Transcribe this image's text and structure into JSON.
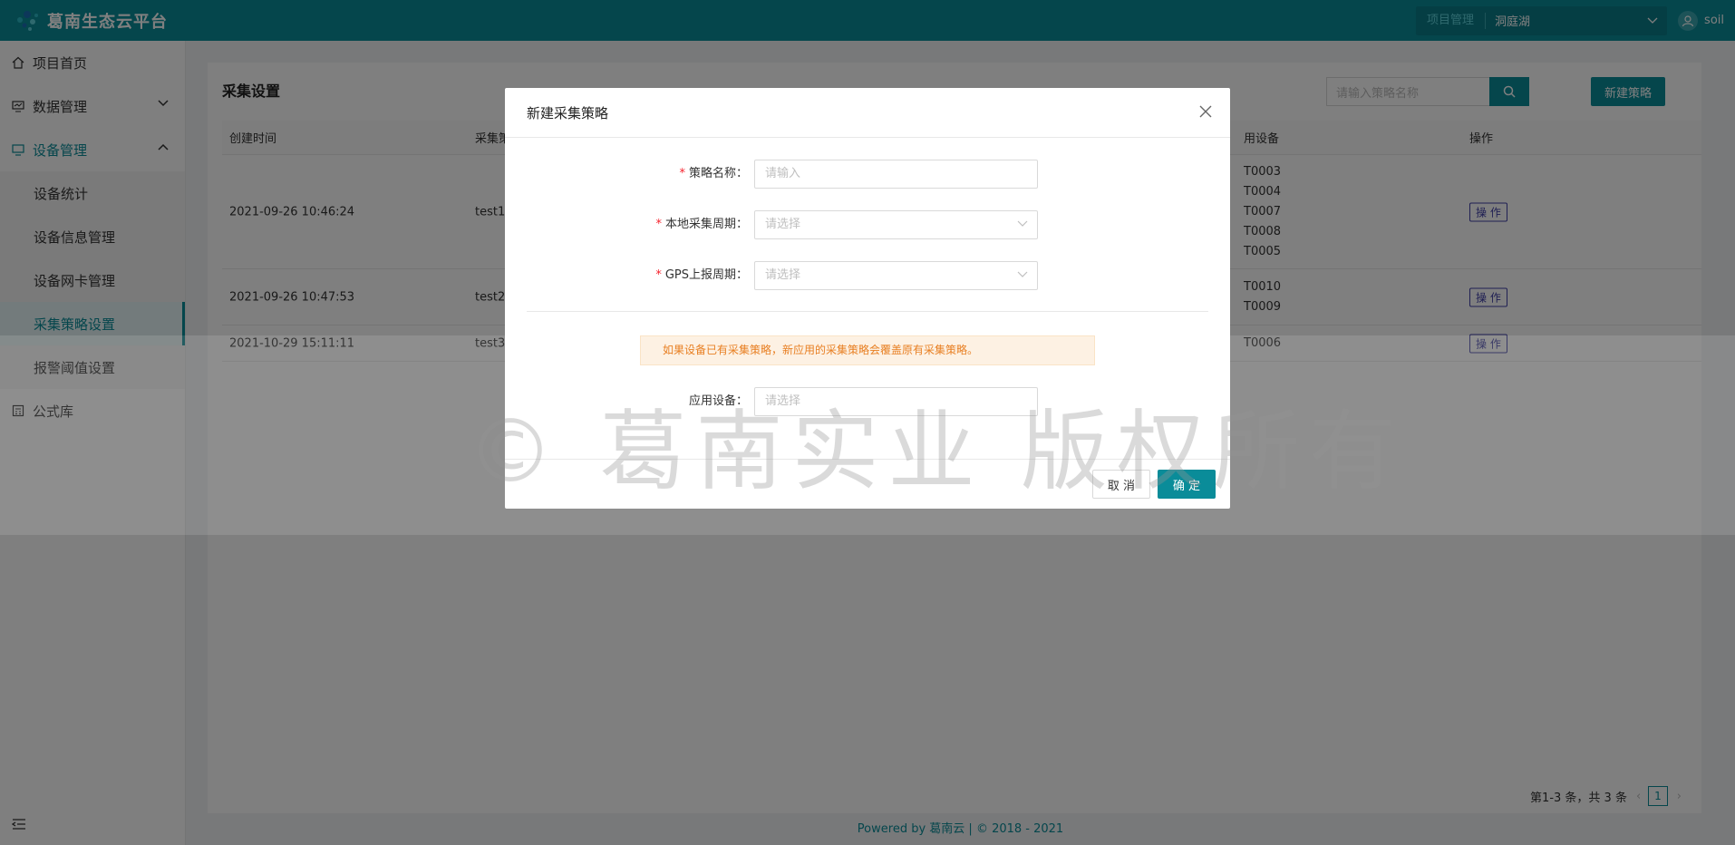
{
  "header": {
    "app_title": "葛南生态云平台",
    "project_label": "项目管理",
    "project_value": "洞庭湖",
    "user_name": "soil"
  },
  "sidebar": {
    "items": [
      {
        "label": "项目首页",
        "icon": "home-icon"
      },
      {
        "label": "数据管理",
        "icon": "monitor-icon"
      },
      {
        "label": "设备管理",
        "icon": "device-icon"
      },
      {
        "label": "公式库",
        "icon": "calc-icon"
      }
    ],
    "sub_items": [
      {
        "label": "设备统计"
      },
      {
        "label": "设备信息管理"
      },
      {
        "label": "设备网卡管理"
      },
      {
        "label": "采集策略设置"
      },
      {
        "label": "报警阈值设置"
      }
    ]
  },
  "page": {
    "title": "采集设置",
    "search_placeholder": "请输入策略名称",
    "new_button": "新建策略"
  },
  "table": {
    "columns": [
      "创建时间",
      "采集策",
      "用设备",
      "操作"
    ],
    "rows": [
      {
        "created": "2021-09-26 10:46:24",
        "name": "test1",
        "devices": [
          "T0003",
          "T0004",
          "T0007",
          "T0008",
          "T0005"
        ],
        "op": "操 作"
      },
      {
        "created": "2021-09-26 10:47:53",
        "name": "test2",
        "devices": [
          "T0010",
          "T0009"
        ],
        "op": "操 作"
      },
      {
        "created": "2021-10-29 15:11:11",
        "name": "test3",
        "devices": [
          "T0006"
        ],
        "op": "操 作"
      }
    ]
  },
  "pager": {
    "summary": "第1-3 条，共 3 条",
    "current": "1"
  },
  "footer": {
    "prefix": "Powered by ",
    "brand": "葛南云",
    "suffix": " | © 2018 - 2021"
  },
  "watermark": "©  葛南实业 版权所有",
  "modal": {
    "title": "新建采集策略",
    "fields": [
      {
        "label": "策略名称：",
        "placeholder": "请输入",
        "required": true
      },
      {
        "label": "本地采集周期：",
        "placeholder": "请选择",
        "required": true
      },
      {
        "label": "GPS上报周期：",
        "placeholder": "请选择",
        "required": true
      }
    ],
    "alert": "如果设备已有采集策略，新应用的采集策略会覆盖原有采集策略。",
    "device_label": "应用设备：",
    "device_placeholder": "请选择",
    "cancel": "取 消",
    "ok": "确 定"
  },
  "colors": {
    "primary": "#0a8c99",
    "required": "#f5222d",
    "alert_text": "#e87f22"
  }
}
